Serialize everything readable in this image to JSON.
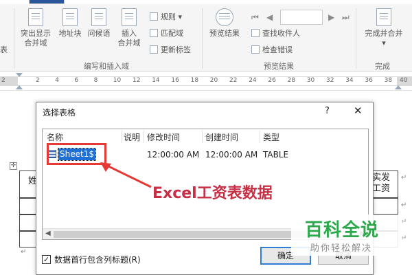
{
  "ribbon": {
    "buttons": {
      "highlight_merge": "突出显示\n合并域",
      "address_block": "地址块",
      "greeting_line": "问候语",
      "insert_merge_field": "插入\n合并域",
      "preview_results": "预览结果",
      "finish_merge": "完成并合并"
    },
    "small": {
      "rules": "规则",
      "match_fields": "匹配域",
      "update_labels": "更新标签",
      "find_recipient": "查找收件人",
      "check_errors": "检查错误"
    },
    "groups": {
      "write_insert": "编写和插入域",
      "preview": "预览结果",
      "finish": "完成"
    },
    "partial_left": "表"
  },
  "ruler": {
    "left_label": "2",
    "numbers": [
      "2",
      "4",
      "6",
      "8",
      "10",
      "12",
      "14",
      "16",
      "18",
      "20",
      "22",
      "24",
      "26",
      "28",
      "30",
      "32",
      "34",
      "36",
      "38"
    ],
    "right_label": "40"
  },
  "document": {
    "left_cell_text": "姓",
    "right_cell_line1": "实发",
    "right_cell_line2": "工资"
  },
  "dialog": {
    "title": "选择表格",
    "help": "?",
    "close": "✕",
    "columns": [
      "名称",
      "说明",
      "修改时间",
      "创建时间",
      "类型"
    ],
    "rows": [
      {
        "name": "Sheet1$",
        "description": "",
        "modified": "12:00:00 AM",
        "created": "12:00:00 AM",
        "type": "TABLE"
      }
    ],
    "checkbox_label": "数据首行包含列标题(R)",
    "checkbox_checked": "✓",
    "ok_label": "确定",
    "cancel_label": "取消"
  },
  "annotation": {
    "text": "Excel工资表数据",
    "color": "#c62f45"
  },
  "watermark": {
    "line1": "百科全说",
    "line2": "助你轻松解决",
    "color": "#2aa84a"
  },
  "colors": {
    "selection": "#1e6fd6",
    "highlight_box": "#e53935"
  }
}
